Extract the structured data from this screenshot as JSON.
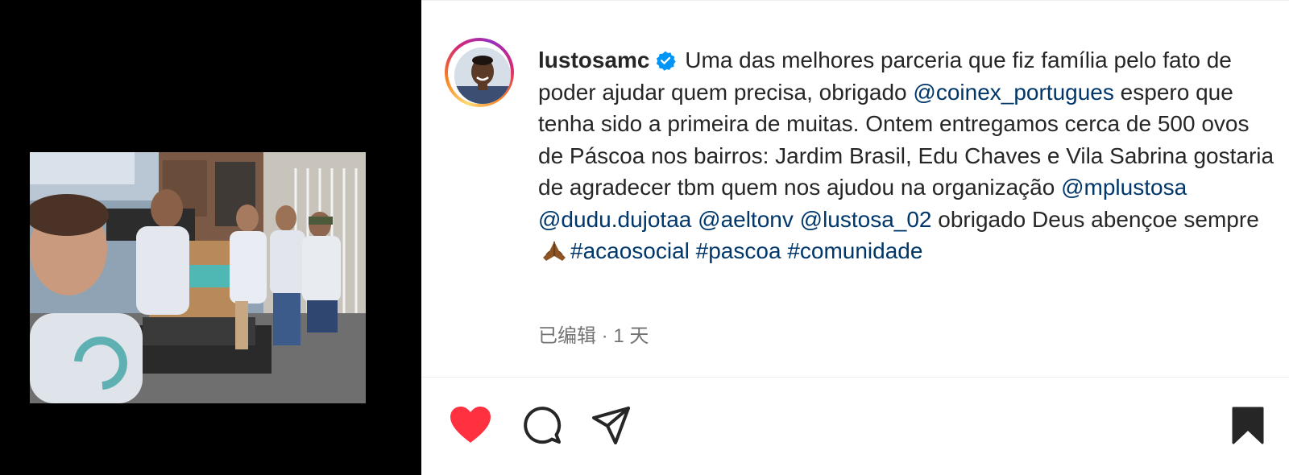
{
  "post": {
    "username": "lustosamc",
    "verified": true,
    "caption": {
      "t1": " Uma das melhores parceria que fiz família pelo fato de poder ajudar quem precisa, obrigado ",
      "m1": "@coinex_portugues",
      "t2": " espero que tenha sido a primeira de muitas. Ontem entregamos cerca de 500 ovos de Páscoa nos bairros: Jardim Brasil, Edu Chaves e Vila Sabrina gostaria de agradecer tbm quem nos ajudou na organização ",
      "m2": "@mplustosa",
      "s1": " ",
      "m3": "@dudu.dujotaa",
      "s2": " ",
      "m4": "@aeltonv",
      "s3": " ",
      "m5": "@lustosa_02",
      "t3": " obrigado Deus abençoe sempre ",
      "h1": "#acaosocial",
      "s4": " ",
      "h2": "#pascoa",
      "s5": " ",
      "h3": "#comunidade"
    },
    "meta": "已编辑 · 1 天"
  },
  "actions": {
    "liked": true,
    "saved": true,
    "like_color": "#ff3040"
  },
  "icons": [
    "verified-badge-icon",
    "folded-hands-emoji",
    "heart-icon",
    "comment-icon",
    "share-icon",
    "bookmark-icon"
  ],
  "colors": {
    "link": "#00376b",
    "text": "#262626",
    "meta": "#737373",
    "verified": "#0095f6",
    "media_background": "#000000"
  }
}
